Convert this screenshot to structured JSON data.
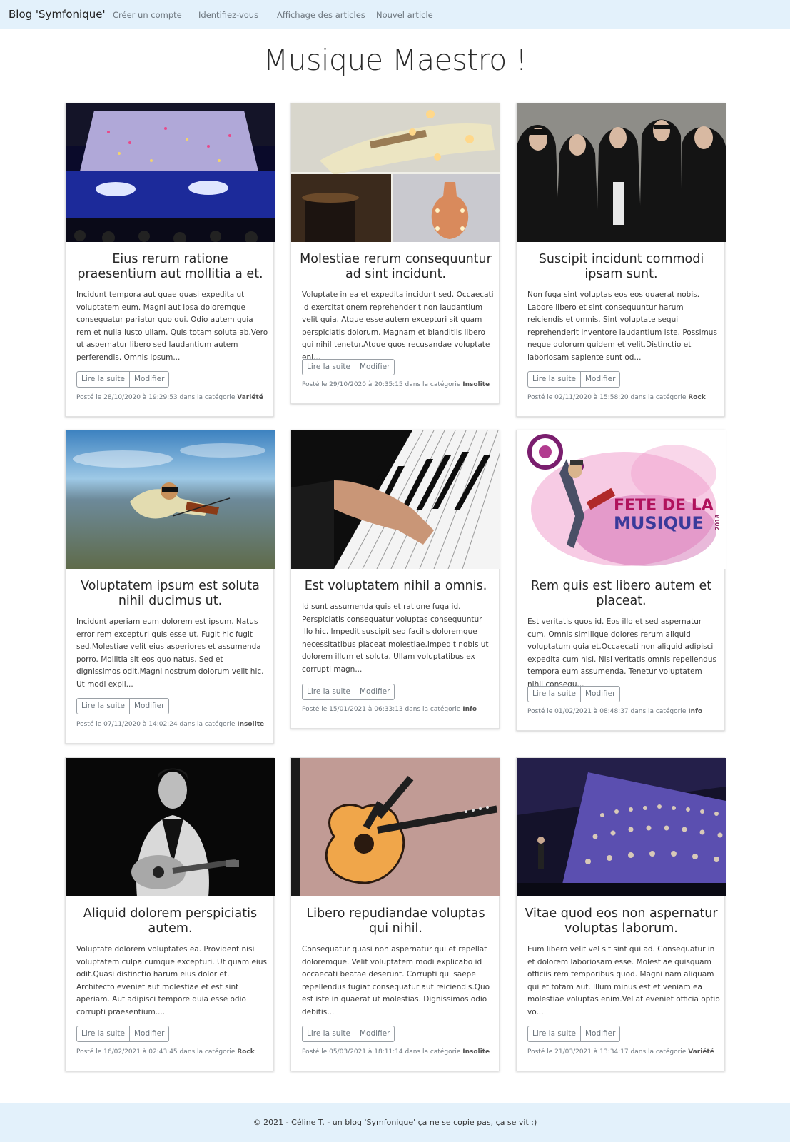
{
  "nav": {
    "brand": "Blog 'Symfonique'",
    "links": [
      "Créer un compte",
      "Identifiez-vous",
      "Affichage des articles",
      "Nouvel article"
    ]
  },
  "page_title": "Musique Maestro !",
  "buttons": {
    "read_more": "Lire la suite",
    "edit": "Modifier"
  },
  "articles": [
    {
      "title": "Eius rerum ratione praesentium aut mollitia a et.",
      "excerpt": "Incidunt tempora aut quae quasi expedita ut voluptatem eum. Magni aut ipsa doloremque consequatur pariatur quo qui. Odio autem quia rem et nulla iusto ullam. Quis totam soluta ab.Vero ut aspernatur libero sed laudantium autem perferendis. Omnis ipsum...",
      "posted": "Posté le 28/10/2020 à 19:29:53 dans la catégorie",
      "category": "Variété",
      "image": "choir-concert-photo"
    },
    {
      "title": "Molestiae rerum consequuntur ad sint incidunt.",
      "excerpt": "Voluptate in ea et expedita incidunt sed. Occaecati id exercitationem reprehenderit non laudantium velit quia. Atque esse autem excepturi sit quam perspiciatis dolorum. Magnam et blanditiis libero qui nihil tenetur.Atque quos recusandae voluptate eni...",
      "posted": "Posté le 29/10/2020 à 20:35:15 dans la catégorie",
      "category": "Insolite",
      "image": "guitar-lamps-photo"
    },
    {
      "title": "Suscipit incidunt commodi ipsam sunt.",
      "excerpt": "Non fuga sint voluptas eos eos quaerat nobis. Labore libero et sint consequuntur harum reiciendis et omnis. Sint voluptate sequi reprehenderit inventore laudantium iste. Possimus neque dolorum quidem et velit.Distinctio et laboriosam sapiente sunt od...",
      "posted": "Posté le 02/11/2020 à 15:58:20 dans la catégorie",
      "category": "Rock",
      "image": "rock-band-photo"
    },
    {
      "title": "Voluptatem ipsum est soluta nihil ducimus ut.",
      "excerpt": "Incidunt aperiam eum dolorem est ipsum. Natus error rem excepturi quis esse ut. Fugit hic fugit sed.Molestiae velit eius asperiores et assumenda porro. Mollitia sit eos quo natus. Sed et dignissimos odit.Magni nostrum dolorum velit hic. Ut modi expli...",
      "posted": "Posté le 07/11/2020 à 14:02:24 dans la catégorie",
      "category": "Insolite",
      "image": "skydiving-violinist-photo"
    },
    {
      "title": "Est voluptatem nihil a omnis.",
      "excerpt": "Id sunt assumenda quis et ratione fuga id. Perspiciatis consequatur voluptas consequuntur illo hic. Impedit suscipit sed facilis doloremque necessitatibus placeat molestiae.Impedit nobis ut dolorem illum et soluta. Ullam voluptatibus ex corrupti magn...",
      "posted": "Posté le 15/01/2021 à 06:33:13 dans la catégorie",
      "category": "Info",
      "image": "piano-hands-photo"
    },
    {
      "title": "Rem quis est libero autem et placeat.",
      "excerpt": "Est veritatis quos id. Eos illo et sed aspernatur cum. Omnis similique dolores rerum aliquid voluptatum quia et.Occaecati non aliquid adipisci expedita cum nisi. Nisi veritatis omnis repellendus tempora eum assumenda. Tenetur voluptatem nihil consequ...",
      "posted": "Posté le 01/02/2021 à 08:48:37 dans la catégorie",
      "category": "Info",
      "image": "fete-de-la-musique-poster",
      "poster_text": [
        "FETE DE LA",
        "MUSIQUE",
        "2018"
      ]
    },
    {
      "title": "Aliquid dolorem perspiciatis autem.",
      "excerpt": "Voluptate dolorem voluptates ea. Provident nisi voluptatem culpa cumque excepturi. Ut quam eius odit.Quasi distinctio harum eius dolor et. Architecto eveniet aut molestiae et est sint aperiam. Aut adipisci tempore quia esse odio corrupti praesentium....",
      "posted": "Posté le 16/02/2021 à 02:43:45 dans la catégorie",
      "category": "Rock",
      "image": "acoustic-guitarist-photo"
    },
    {
      "title": "Libero repudiandae voluptas qui nihil.",
      "excerpt": "Consequatur quasi non aspernatur qui et repellat doloremque. Velit voluptatem modi explicabo id occaecati beatae deserunt. Corrupti qui saepe repellendus fugiat consequatur aut reiciendis.Quo est iste in quaerat ut molestias. Dignissimos odio debitis...",
      "posted": "Posté le 05/03/2021 à 18:11:14 dans la catégorie",
      "category": "Insolite",
      "image": "multi-neck-guitar-photo"
    },
    {
      "title": "Vitae quod eos non aspernatur voluptas laborum.",
      "excerpt": "Eum libero velit vel sit sint qui ad. Consequatur in et dolorem laboriosam esse. Molestiae quisquam officiis rem temporibus quod. Magni nam aliquam qui et totam aut. Illum minus est et veniam ea molestiae voluptas enim.Vel at eveniet officia optio vo...",
      "posted": "Posté le 21/03/2021 à 13:34:17 dans la catégorie",
      "category": "Variété",
      "image": "choir-stage-photo"
    }
  ],
  "footer": "© 2021 - Céline T. - un blog 'Symfonique' ça ne se copie pas, ça se vit :)"
}
